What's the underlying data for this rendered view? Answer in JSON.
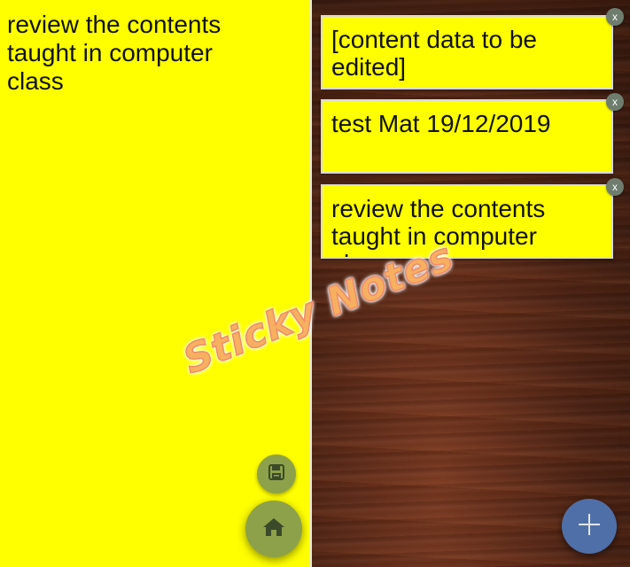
{
  "editor": {
    "text": "review the contents\ntaught in computer\nclass",
    "save_icon": "save-icon",
    "home_icon": "home-icon",
    "bg_color": "#ffff00",
    "fab_color": "#8da14a"
  },
  "board": {
    "notes": [
      {
        "text": "[content data to be\nedited]",
        "close_label": "x"
      },
      {
        "text": "test Mat 19/12/2019",
        "close_label": "x"
      },
      {
        "text": "review the contents\ntaught in computer\nclass",
        "close_label": "x"
      }
    ],
    "add_icon": "plus-icon",
    "add_color": "#4f6fa8"
  },
  "watermark": {
    "text": "Sticky Notes"
  }
}
